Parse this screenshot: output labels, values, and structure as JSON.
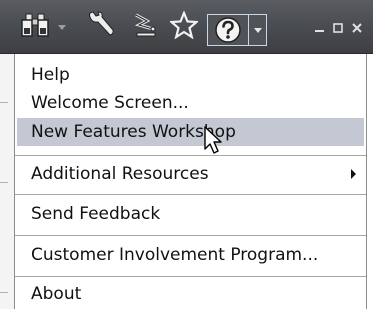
{
  "toolbar": {
    "icons": [
      "binoculars-icon",
      "wrench-icon",
      "satellite-icon",
      "star-icon",
      "help-icon"
    ],
    "window_controls": [
      "minimize-icon",
      "restore-icon",
      "close-icon"
    ]
  },
  "menu": {
    "items": [
      {
        "label": "Help"
      },
      {
        "label": "Welcome Screen..."
      },
      {
        "label": "New Features Workshop",
        "highlighted": true
      },
      {
        "label": "Additional Resources",
        "submenu": true
      },
      {
        "label": "Send Feedback"
      },
      {
        "label": "Customer Involvement Program..."
      },
      {
        "label": "About"
      }
    ]
  },
  "colors": {
    "toolbar": "#4a4d51",
    "highlight": "#c4c8d2",
    "menu_bg": "#ffffff"
  }
}
